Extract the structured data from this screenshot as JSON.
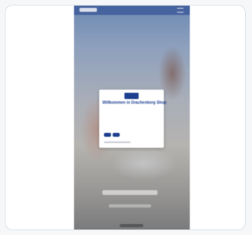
{
  "modal": {
    "title": "Willkommen in Drachenberg Shop",
    "body": "",
    "question": "",
    "no_label": "",
    "yes_label": ""
  }
}
